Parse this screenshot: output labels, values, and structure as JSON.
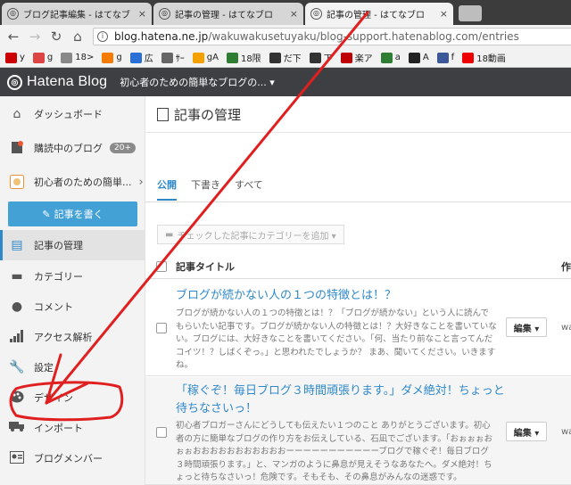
{
  "browser": {
    "tabs": [
      {
        "title": "ブログ記事編集 - はてなブ"
      },
      {
        "title": "記事の管理 - はてなブロ"
      },
      {
        "title": "記事の管理 - はてなブロ"
      }
    ],
    "close_glyph": "×",
    "url_host": "blog.hatena.ne.jp",
    "url_path": "/wakuwakusetuyaku/blog-support.hatenablog.com/entries",
    "bookmarks": [
      {
        "label": "y",
        "icon": "yahoo-icon",
        "color": "#c00"
      },
      {
        "label": "g",
        "icon": "gmail-icon",
        "color": "#d44"
      },
      {
        "label": "18>",
        "icon": "page-icon",
        "color": "#888"
      },
      {
        "label": "g",
        "icon": "blogger-icon",
        "color": "#f57c00"
      },
      {
        "label": "広",
        "icon": "adwords-icon",
        "color": "#2a6fd6"
      },
      {
        "label": "ｻｰ",
        "icon": "search-console-icon",
        "color": "#666"
      },
      {
        "label": "gA",
        "icon": "analytics-icon",
        "color": "#f4a100"
      },
      {
        "label": "18限",
        "icon": "pen-icon",
        "color": "#2e7d32"
      },
      {
        "label": "だ下",
        "icon": "hatena-icon",
        "color": "#333"
      },
      {
        "label": "下",
        "icon": "hatena-icon",
        "color": "#333"
      },
      {
        "label": "楽ア",
        "icon": "rakuten-icon",
        "color": "#bf0000"
      },
      {
        "label": "a",
        "icon": "ameba-icon",
        "color": "#2e7d32"
      },
      {
        "label": "A",
        "icon": "amazon-icon",
        "color": "#222"
      },
      {
        "label": "f",
        "icon": "facebook-icon",
        "color": "#3b5998"
      },
      {
        "label": "18動画",
        "icon": "youtube-icon",
        "color": "#e00"
      }
    ]
  },
  "header": {
    "logo_text": "Hatena Blog",
    "blog_name": "初心者のための簡単なブログの... ▾"
  },
  "sidebar": {
    "items": [
      {
        "label": "ダッシュボード",
        "icon": "home-icon"
      },
      {
        "label": "購読中のブログ",
        "icon": "bookmark-icon",
        "badge": "20+"
      },
      {
        "label": "初心者のための簡単...",
        "icon": "blog-avatar-icon"
      },
      {
        "label": "記事の管理",
        "icon": "document-icon"
      },
      {
        "label": "カテゴリー",
        "icon": "folder-icon"
      },
      {
        "label": "コメント",
        "icon": "comment-icon"
      },
      {
        "label": "アクセス解析",
        "icon": "chart-icon"
      },
      {
        "label": "設定",
        "icon": "wrench-icon"
      },
      {
        "label": "デザイン",
        "icon": "palette-icon"
      },
      {
        "label": "インポート",
        "icon": "truck-icon"
      },
      {
        "label": "ブログメンバー",
        "icon": "member-icon"
      }
    ],
    "write_button": "記事を書く"
  },
  "main": {
    "title": "記事の管理",
    "tabs": [
      "公開",
      "下書き",
      "すべて"
    ],
    "category_button": "チェックした記事にカテゴリーを追加 ▾",
    "column_title": "記事タイトル",
    "column_cut": "作",
    "rows": [
      {
        "title": "ブログが続かない人の１つの特徴とは！？",
        "excerpt": "ブログが続かない人の１つの特徴とは！？「ブログが続かない」という人に読んでもらいたい記事です。ブログが続かない人の特徴とは！？大好きなことを書いていない。ブログには、大好きなことを書いてください。「何、当たり前なこと言ってんだコイツ！？しばくぞっ。」と思われたでしょうか？ まあ、聞いてください。いきますね。",
        "edit": "編集 ▾",
        "cut": "wa"
      },
      {
        "title": "「稼ぐぞ！毎日ブログ３時間頑張ります。」ダメ絶対！ちょっと待ちなさいっ！",
        "excerpt": "初心者ブロガーさんにどうしても伝えたい１つのこと ありがとうございます。初心者の方に簡単なブログの作り方をお伝えしている、石凪でございます。「おぉぉぉおぉぉおおおおおおおおおおおーーーーーーーーーーーブログで稼ぐぞ！毎日ブログ３時間頑張ります。」と、マンガのように鼻息が見えそうなあなたへ。ダメ絶対！ちょっと待ちなさいっ！危険です。そもそも、その鼻息がみんなの迷惑です。",
        "edit": "編集 ▾",
        "cut": "wa"
      }
    ]
  },
  "annotation_color": "#e02020"
}
